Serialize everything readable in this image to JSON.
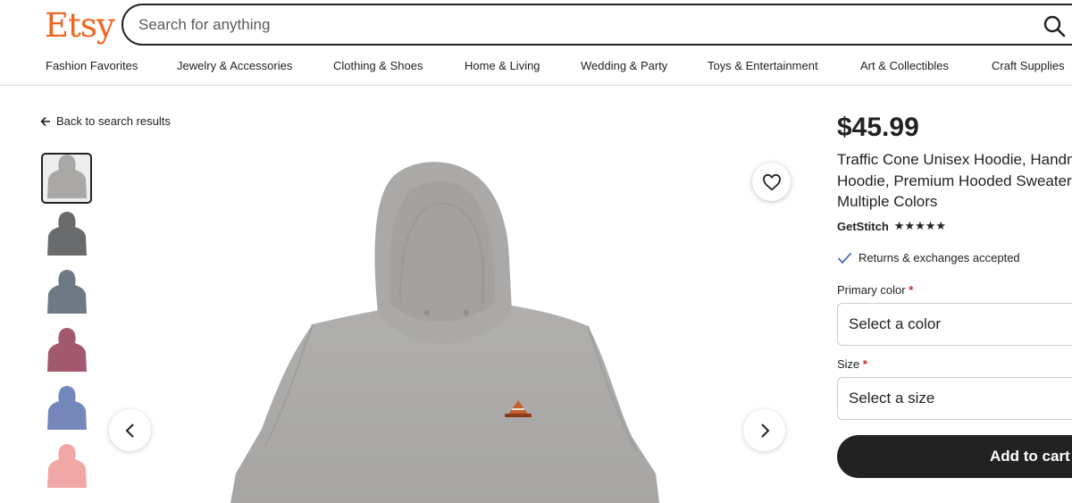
{
  "header": {
    "logo": "Etsy",
    "search": {
      "placeholder": "Search for anything",
      "value": ""
    },
    "nav": [
      "Fashion Favorites",
      "Jewelry & Accessories",
      "Clothing & Shoes",
      "Home & Living",
      "Wedding & Party",
      "Toys & Entertainment",
      "Art & Collectibles",
      "Craft Supplies"
    ]
  },
  "back_link": "Back to search results",
  "thumbnails": [
    {
      "name": "thumb-carbon-grey",
      "color": "#a9a8a6",
      "selected": true
    },
    {
      "name": "thumb-charcoal",
      "color": "#6a6b6c"
    },
    {
      "name": "thumb-slate-blue",
      "color": "#6f7885"
    },
    {
      "name": "thumb-mauve",
      "color": "#a2596d"
    },
    {
      "name": "thumb-periwinkle",
      "color": "#7387ba"
    },
    {
      "name": "thumb-peach",
      "color": "#f1a7a3"
    }
  ],
  "product": {
    "price": "$45.99",
    "title_lines": [
      "Traffic Cone Unisex Hoodie, Handm",
      "Hoodie, Premium Hooded Sweater,",
      "Multiple Colors"
    ],
    "shop_name": "GetStitch",
    "stars": "★★★★★",
    "returns": "Returns & exchanges accepted",
    "primary_color_label": "Primary color",
    "primary_color_placeholder": "Select a color",
    "size_label": "Size",
    "size_placeholder": "Select a size",
    "required_mark": "*",
    "add_to_cart": "Add to cart"
  },
  "colors": {
    "brand": "#F1641E",
    "hoodie": "#a9a8a6",
    "dark": "#222222"
  }
}
